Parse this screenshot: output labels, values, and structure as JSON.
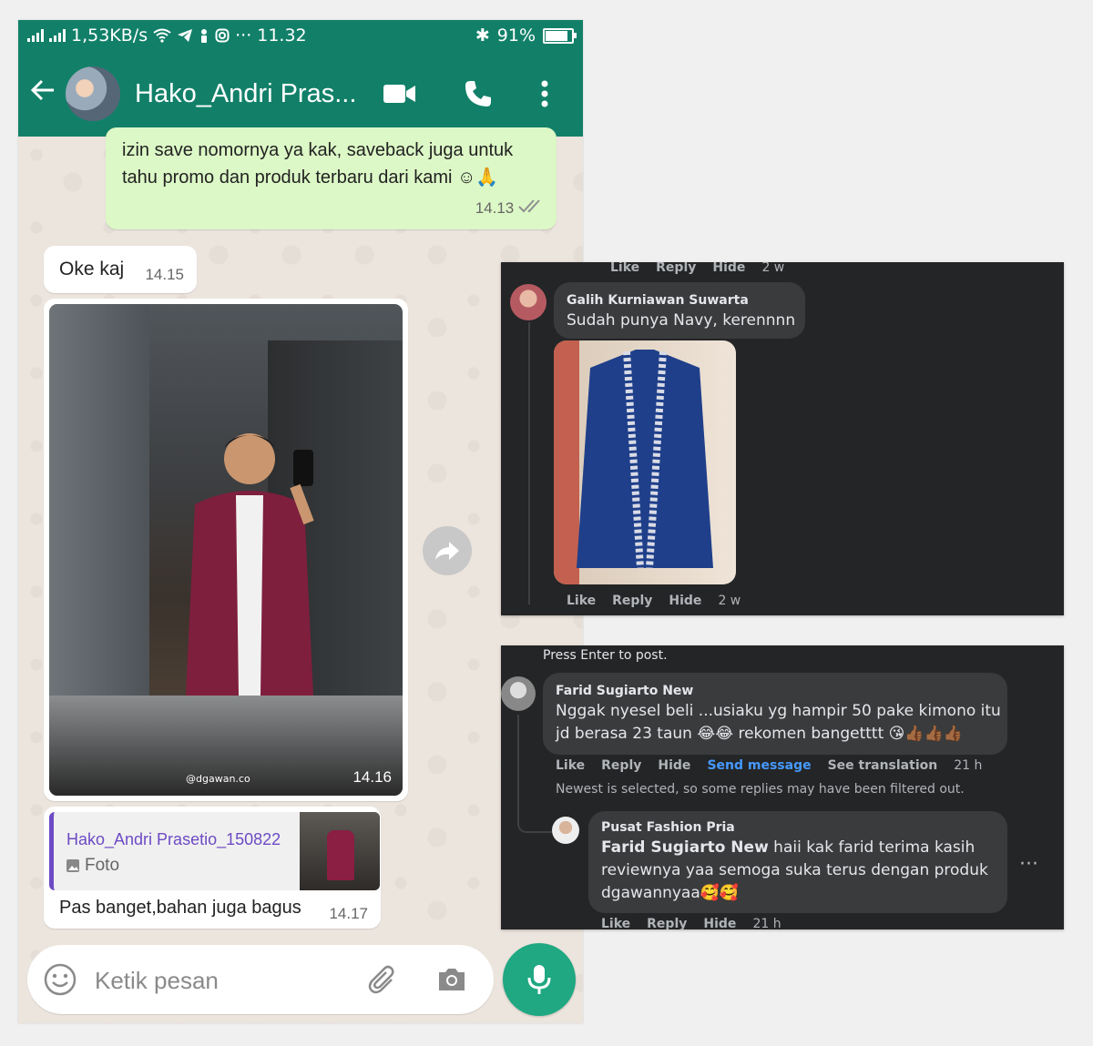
{
  "whatsapp": {
    "status_bar": {
      "speed": "1,53KB/s",
      "time": "11.32",
      "battery": "91%",
      "overflow": "···"
    },
    "header": {
      "back_icon": "arrow-left-icon",
      "contact_name": "Hako_Andri Pras...",
      "video_icon": "video-call-icon",
      "call_icon": "phone-icon",
      "menu_icon": "more-vertical-icon"
    },
    "messages": {
      "outgoing_text": "izin save nomornya ya kak, saveback juga untuk tahu promo dan produk terbaru dari kami ☺🙏",
      "outgoing_time": "14.13",
      "incoming_text": "Oke kaj",
      "incoming_time": "14.15",
      "image_watermark": "@dgawan.co",
      "image_time": "14.16",
      "reply_quote_name": "Hako_Andri Prasetio_150822",
      "reply_quote_kind": "Foto",
      "reply_text": "Pas banget,bahan juga bagus",
      "reply_time": "14.17"
    },
    "input": {
      "placeholder": "Ketik pesan"
    },
    "colors": {
      "header": "#128069",
      "outgoing_bubble": "#dcf8c6",
      "mic_button": "#1fa882"
    }
  },
  "facebook_comments_1": {
    "top_actions": {
      "like": "Like",
      "reply": "Reply",
      "hide": "Hide",
      "age": "2 w"
    },
    "comment": {
      "author": "Galih Kurniawan Suwarta",
      "text": "Sudah punya Navy, kerennnn"
    },
    "actions": {
      "like": "Like",
      "reply": "Reply",
      "hide": "Hide",
      "age": "2 w"
    }
  },
  "facebook_comments_2": {
    "hint": "Press Enter to post.",
    "comment": {
      "author": "Farid Sugiarto New",
      "line1": "Nggak nyesel beli ...usiaku yg hampir 50 pake kimono itu",
      "line2": "jd berasa 23 taun 😂😂 rekomen bangetttt 😘👍🏾👍🏾👍🏾"
    },
    "actions": {
      "like": "Like",
      "reply": "Reply",
      "hide": "Hide",
      "send": "Send message",
      "translate": "See translation",
      "age": "21 h"
    },
    "filter_note": "Newest is selected, so some replies may have been filtered out.",
    "reply": {
      "author": "Pusat Fashion Pria",
      "mention": "Farid Sugiarto New",
      "line1": " haii kak farid terima kasih",
      "line2": "reviewnya yaa semoga suka terus dengan produk",
      "line3": "dgawannyaa🥰🥰"
    },
    "reply_actions": {
      "like": "Like",
      "reply": "Reply",
      "hide": "Hide",
      "age": "21 h"
    },
    "more": "···"
  }
}
